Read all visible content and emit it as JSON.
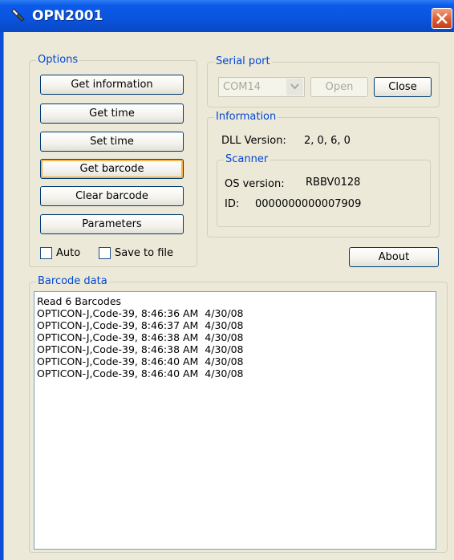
{
  "window": {
    "title": "OPN2001",
    "icon": "scanner-icon"
  },
  "options": {
    "label": "Options",
    "buttons": [
      "Get information",
      "Get time",
      "Set time",
      "Get barcode",
      "Clear barcode",
      "Parameters"
    ],
    "auto_label": "Auto",
    "save_label": "Save to file"
  },
  "serial": {
    "label": "Serial port",
    "port": "COM14",
    "open_label": "Open",
    "close_label": "Close"
  },
  "information": {
    "label": "Information",
    "dll_label": "DLL Version:",
    "dll_value": "2, 0, 6, 0",
    "scanner": {
      "label": "Scanner",
      "os_label": "OS version:",
      "os_value": "RBBV0128",
      "id_label": "ID:",
      "id_value": "0000000000007909"
    }
  },
  "about_label": "About",
  "barcode": {
    "label": "Barcode data",
    "lines": [
      "Read 6 Barcodes",
      "OPTICON-J,Code-39, 8:46:36 AM  4/30/08",
      "OPTICON-J,Code-39, 8:46:37 AM  4/30/08",
      "OPTICON-J,Code-39, 8:46:38 AM  4/30/08",
      "OPTICON-J,Code-39, 8:46:38 AM  4/30/08",
      "OPTICON-J,Code-39, 8:46:40 AM  4/30/08",
      "OPTICON-J,Code-39, 8:46:40 AM  4/30/08"
    ]
  },
  "colors": {
    "titlebar": "#0a55df",
    "dialog": "#ece9d8",
    "group_label": "#0046d5",
    "close": "#d9572c"
  }
}
